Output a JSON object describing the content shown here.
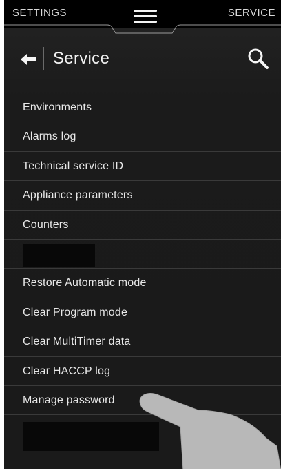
{
  "topbar": {
    "left_tab": "SETTINGS",
    "right_tab": "SERVICE",
    "menu_icon": "hamburger-icon"
  },
  "header": {
    "back_icon": "arrow-left-icon",
    "title": "Service",
    "search_icon": "search-icon"
  },
  "menu": {
    "items": [
      {
        "label": "Environments"
      },
      {
        "label": "Alarms log"
      },
      {
        "label": "Technical service ID"
      },
      {
        "label": "Appliance parameters"
      },
      {
        "label": "Counters"
      },
      {
        "label": ""
      },
      {
        "label": "Restore Automatic mode"
      },
      {
        "label": "Clear Program mode"
      },
      {
        "label": "Clear MultiTimer data"
      },
      {
        "label": "Clear HACCP log"
      },
      {
        "label": "Manage password"
      }
    ]
  },
  "colors": {
    "background": "#1b1b1b",
    "topbar": "#000000",
    "text": "#e8e8e8",
    "divider": "#3a3a3a",
    "hand_overlay": "#b8b8b8"
  }
}
